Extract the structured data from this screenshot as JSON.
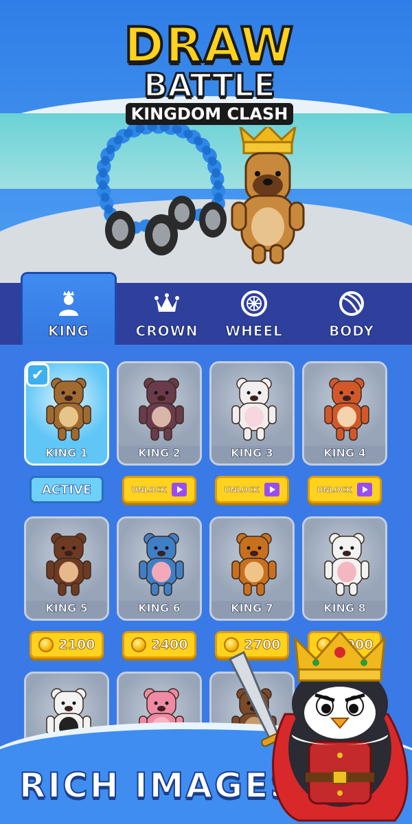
{
  "logo": {
    "line1": "DRAW",
    "line2": "BATTLE",
    "line3": "KINGDOM CLASH"
  },
  "tabs": [
    {
      "label": "KING",
      "icon": "person-crown-icon",
      "active": true
    },
    {
      "label": "CROWN",
      "icon": "crown-icon",
      "active": false
    },
    {
      "label": "WHEEL",
      "icon": "wheel-icon",
      "active": false
    },
    {
      "label": "BODY",
      "icon": "ball-icon",
      "active": false
    }
  ],
  "cards": [
    {
      "label": "KING 1",
      "selected": true,
      "fur": "#a06a30",
      "belly": "#e7c48a",
      "action": {
        "type": "active",
        "text": "ACTIVE"
      }
    },
    {
      "label": "KING 2",
      "selected": false,
      "fur": "#6a3b4a",
      "belly": "#d9b7a8",
      "action": {
        "type": "unlock",
        "text": "UNLOCK"
      }
    },
    {
      "label": "KING 3",
      "selected": false,
      "fur": "#f2eef0",
      "belly": "#f7d6e0",
      "action": {
        "type": "unlock",
        "text": "UNLOCK"
      }
    },
    {
      "label": "KING 4",
      "selected": false,
      "fur": "#d2582a",
      "belly": "#f3d3b0",
      "action": {
        "type": "unlock",
        "text": "UNLOCK"
      }
    },
    {
      "label": "KING 5",
      "selected": false,
      "fur": "#6e3a22",
      "belly": "#e6b88c",
      "action": {
        "type": "price",
        "text": "2100"
      }
    },
    {
      "label": "KING 6",
      "selected": false,
      "fur": "#3f7fc8",
      "belly": "#f4a9b8",
      "action": {
        "type": "price",
        "text": "2400"
      }
    },
    {
      "label": "KING 7",
      "selected": false,
      "fur": "#c9701f",
      "belly": "#f0c489",
      "action": {
        "type": "price",
        "text": "2700"
      }
    },
    {
      "label": "KING 8",
      "selected": false,
      "fur": "#f2f2f2",
      "belly": "#f4b7c1",
      "action": {
        "type": "price",
        "text": "3000"
      }
    },
    {
      "label": "",
      "selected": false,
      "fur": "#f2f2f2",
      "belly": "#222222",
      "action": null
    },
    {
      "label": "",
      "selected": false,
      "fur": "#f08aa4",
      "belly": "#f6b4c4",
      "action": null
    },
    {
      "label": "",
      "selected": false,
      "fur": "#7a4a2a",
      "belly": "#c79a6a",
      "action": null
    }
  ],
  "footer": {
    "tagline": "RICH IMAGES"
  },
  "colors": {
    "accent_yellow": "#ffd21e",
    "tab_bar": "#2e3f9c",
    "grid_bg": "#3a7ae6",
    "active_blue": "#5fc6f6"
  }
}
